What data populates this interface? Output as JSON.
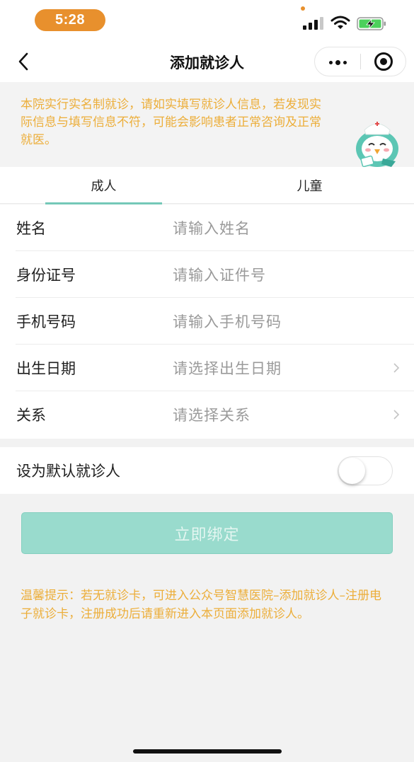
{
  "status_bar": {
    "time": "5:28",
    "time_pill_color": "#e8902d",
    "icons": [
      "cellular-signal-icon",
      "wifi-icon",
      "battery-charging-icon"
    ]
  },
  "nav": {
    "title": "添加就诊人",
    "back_icon": "chevron-left-icon",
    "more_icon": "more-dots-icon",
    "close_icon": "target-close-icon"
  },
  "notice": {
    "text": "本院实行实名制就诊，请如实填写就诊人信息，若发现实际信息与填写信息不符，可能会影响患者正常咨询及正常就医。",
    "color": "#ecae3a",
    "mascot": "nurse-bird-mascot"
  },
  "tabs": {
    "items": [
      {
        "label": "成人",
        "active": true
      },
      {
        "label": "儿童",
        "active": false
      }
    ],
    "accent": "#74c8b8"
  },
  "form": {
    "fields": [
      {
        "label": "姓名",
        "placeholder": "请输入姓名",
        "type": "input"
      },
      {
        "label": "身份证号",
        "placeholder": "请输入证件号",
        "type": "input"
      },
      {
        "label": "手机号码",
        "placeholder": "请输入手机号码",
        "type": "input"
      },
      {
        "label": "出生日期",
        "placeholder": "请选择出生日期",
        "type": "select"
      },
      {
        "label": "关系",
        "placeholder": "请选择关系",
        "type": "select"
      }
    ]
  },
  "default_patient": {
    "label": "设为默认就诊人",
    "enabled": false
  },
  "submit": {
    "label": "立即绑定",
    "color": "#99dbcd"
  },
  "tip": {
    "text": "温馨提示：若无就诊卡，可进入公众号智慧医院–添加就诊人–注册电子就诊卡，注册成功后请重新进入本页面添加就诊人。"
  }
}
